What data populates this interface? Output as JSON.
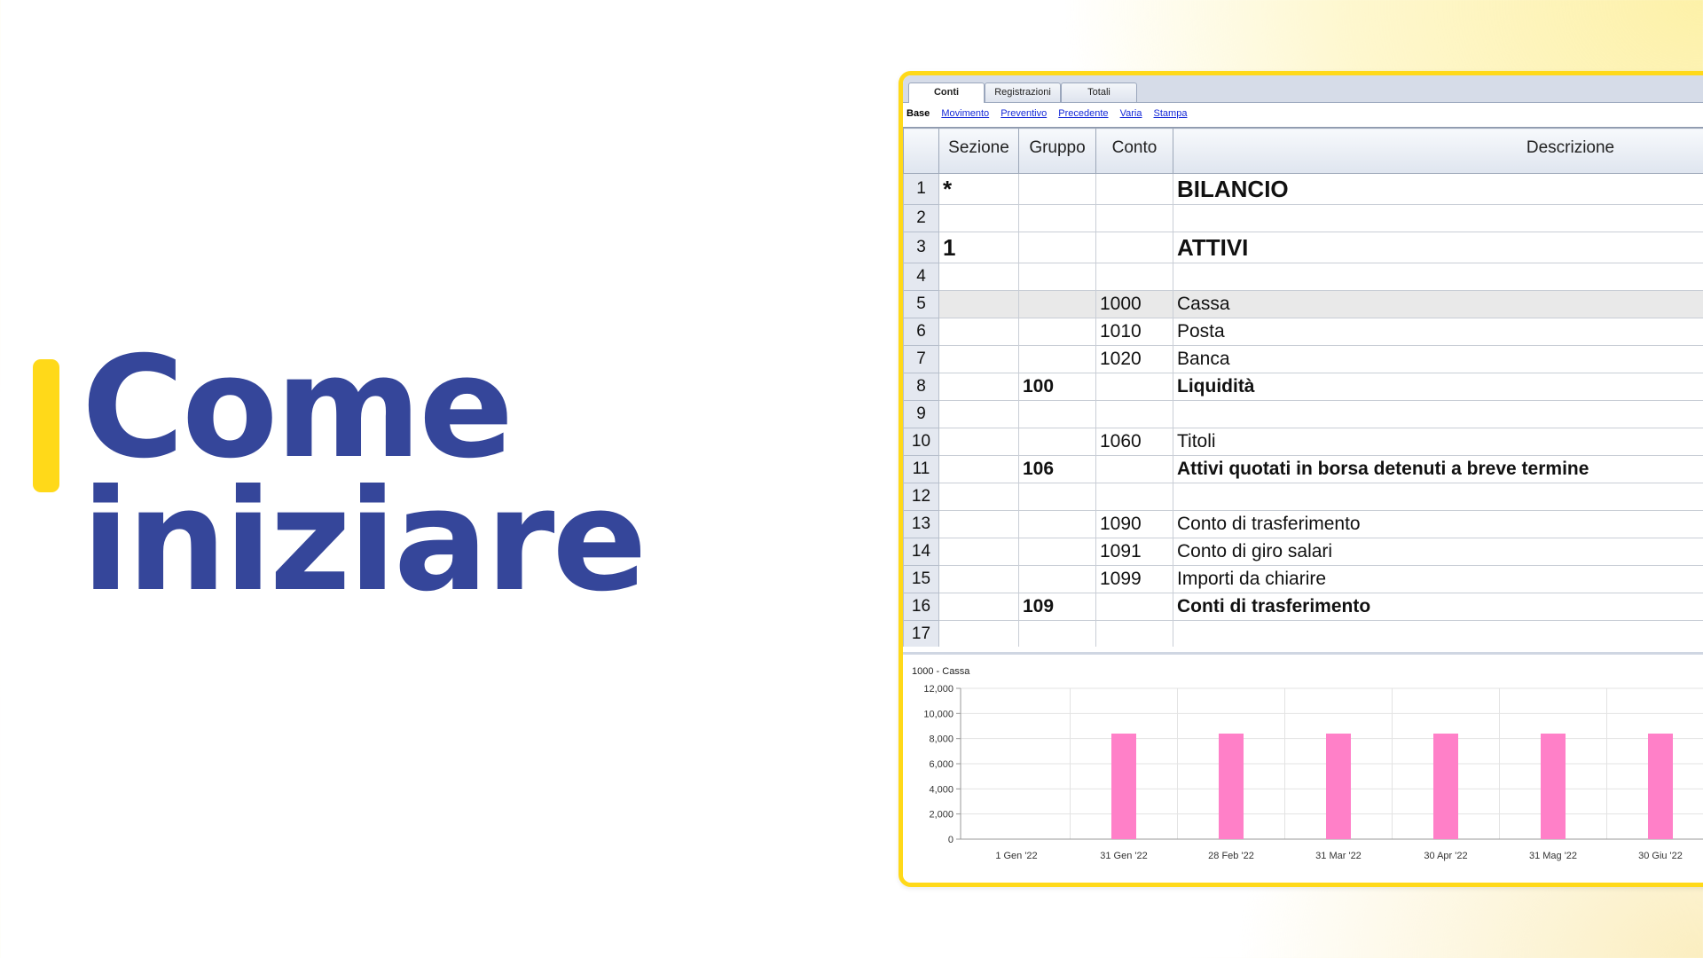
{
  "headline": {
    "line1": "Come",
    "line2": "iniziare"
  },
  "colors": {
    "accent": "#ffd919",
    "headline": "#35469a",
    "bar": "#ff80c8"
  },
  "app": {
    "tabs": [
      {
        "label": "Conti",
        "active": true
      },
      {
        "label": "Registrazioni",
        "active": false
      },
      {
        "label": "Totali",
        "active": false
      }
    ],
    "views": {
      "current": "Base",
      "links": [
        "Movimento",
        "Preventivo",
        "Precedente",
        "Varia",
        "Stampa"
      ]
    },
    "table": {
      "columns": [
        "Sezione",
        "Gruppo",
        "Conto",
        "Descrizione"
      ],
      "rows": [
        {
          "n": "1",
          "sezione": "*",
          "gruppo": "",
          "conto": "",
          "descrizione": "BILANCIO",
          "style": "big"
        },
        {
          "n": "2",
          "sezione": "",
          "gruppo": "",
          "conto": "",
          "descrizione": "",
          "style": ""
        },
        {
          "n": "3",
          "sezione": "1",
          "gruppo": "",
          "conto": "",
          "descrizione": "ATTIVI",
          "style": "big"
        },
        {
          "n": "4",
          "sezione": "",
          "gruppo": "",
          "conto": "",
          "descrizione": "",
          "style": ""
        },
        {
          "n": "5",
          "sezione": "",
          "gruppo": "",
          "conto": "1000",
          "descrizione": "Cassa",
          "style": "sel"
        },
        {
          "n": "6",
          "sezione": "",
          "gruppo": "",
          "conto": "1010",
          "descrizione": "Posta",
          "style": ""
        },
        {
          "n": "7",
          "sezione": "",
          "gruppo": "",
          "conto": "1020",
          "descrizione": "Banca",
          "style": ""
        },
        {
          "n": "8",
          "sezione": "",
          "gruppo": "100",
          "conto": "",
          "descrizione": "Liquidità",
          "style": "bold"
        },
        {
          "n": "9",
          "sezione": "",
          "gruppo": "",
          "conto": "",
          "descrizione": "",
          "style": ""
        },
        {
          "n": "10",
          "sezione": "",
          "gruppo": "",
          "conto": "1060",
          "descrizione": "Titoli",
          "style": ""
        },
        {
          "n": "11",
          "sezione": "",
          "gruppo": "106",
          "conto": "",
          "descrizione": "Attivi quotati in borsa detenuti a breve termine",
          "style": "bold"
        },
        {
          "n": "12",
          "sezione": "",
          "gruppo": "",
          "conto": "",
          "descrizione": "",
          "style": ""
        },
        {
          "n": "13",
          "sezione": "",
          "gruppo": "",
          "conto": "1090",
          "descrizione": "Conto di trasferimento",
          "style": ""
        },
        {
          "n": "14",
          "sezione": "",
          "gruppo": "",
          "conto": "1091",
          "descrizione": "Conto di giro salari",
          "style": ""
        },
        {
          "n": "15",
          "sezione": "",
          "gruppo": "",
          "conto": "1099",
          "descrizione": "Importi da chiarire",
          "style": ""
        },
        {
          "n": "16",
          "sezione": "",
          "gruppo": "109",
          "conto": "",
          "descrizione": "Conti di trasferimento",
          "style": "bold"
        },
        {
          "n": "17",
          "sezione": "",
          "gruppo": "",
          "conto": "",
          "descrizione": "",
          "style": ""
        }
      ]
    }
  },
  "chart_data": {
    "type": "bar",
    "title": "1000 - Cassa",
    "categories": [
      "1 Gen '22",
      "31 Gen '22",
      "28 Feb '22",
      "31 Mar '22",
      "30 Apr '22",
      "31 Mag '22",
      "30 Giu '22"
    ],
    "values": [
      0,
      8400,
      8400,
      8400,
      8400,
      8400,
      8400
    ],
    "yticks": [
      "0",
      "2,000",
      "4,000",
      "6,000",
      "8,000",
      "10,000",
      "12,000"
    ],
    "ylim": [
      0,
      12000
    ],
    "grid": true
  }
}
